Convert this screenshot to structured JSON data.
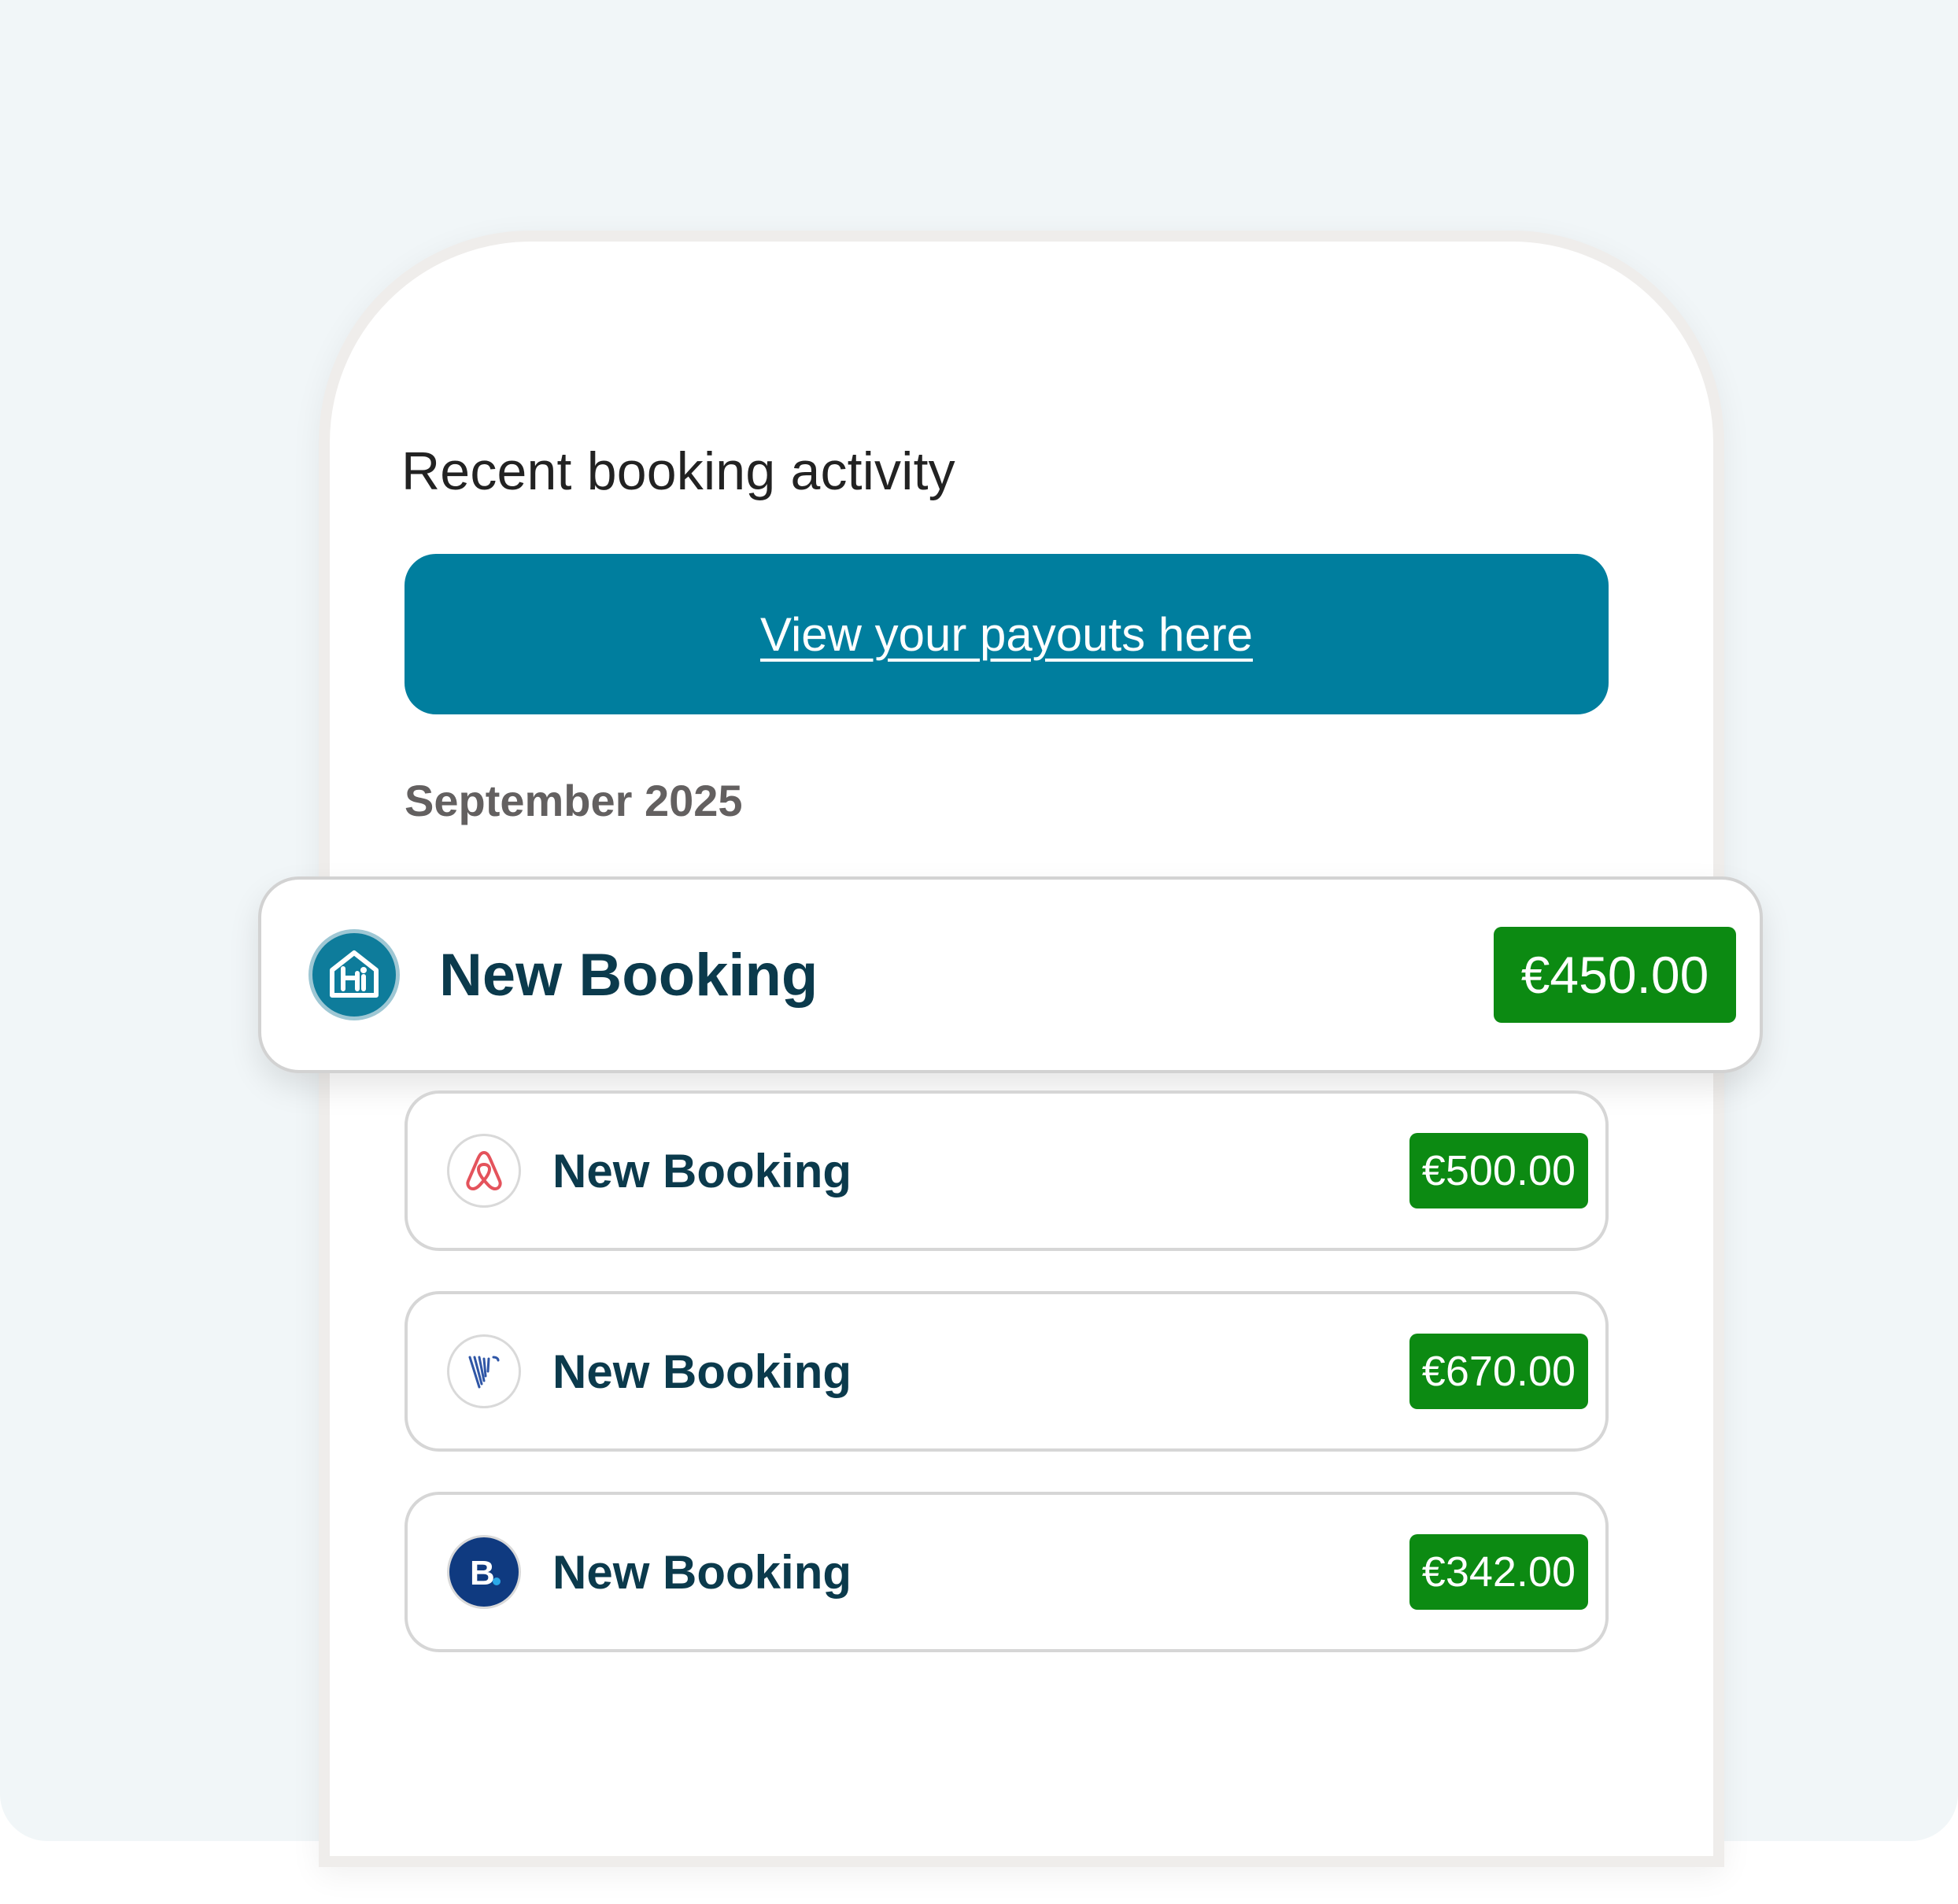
{
  "section": {
    "title": "Recent booking activity"
  },
  "payouts_button": {
    "label": "View your payouts here"
  },
  "month": "September 2025",
  "bookings": [
    {
      "source_icon": "hostaway-icon",
      "title": "New Booking",
      "amount": "€450.00"
    },
    {
      "source_icon": "airbnb-icon",
      "title": "New Booking",
      "amount": "€500.00"
    },
    {
      "source_icon": "vrbo-icon",
      "title": "New Booking",
      "amount": "€670.00"
    },
    {
      "source_icon": "booking-com-icon",
      "title": "New Booking",
      "amount": "€342.00"
    }
  ],
  "colors": {
    "button": "#007e9e",
    "amount_badge": "#0c8a12",
    "booking_title": "#0b3a4c",
    "background": "#f1f6f8"
  }
}
